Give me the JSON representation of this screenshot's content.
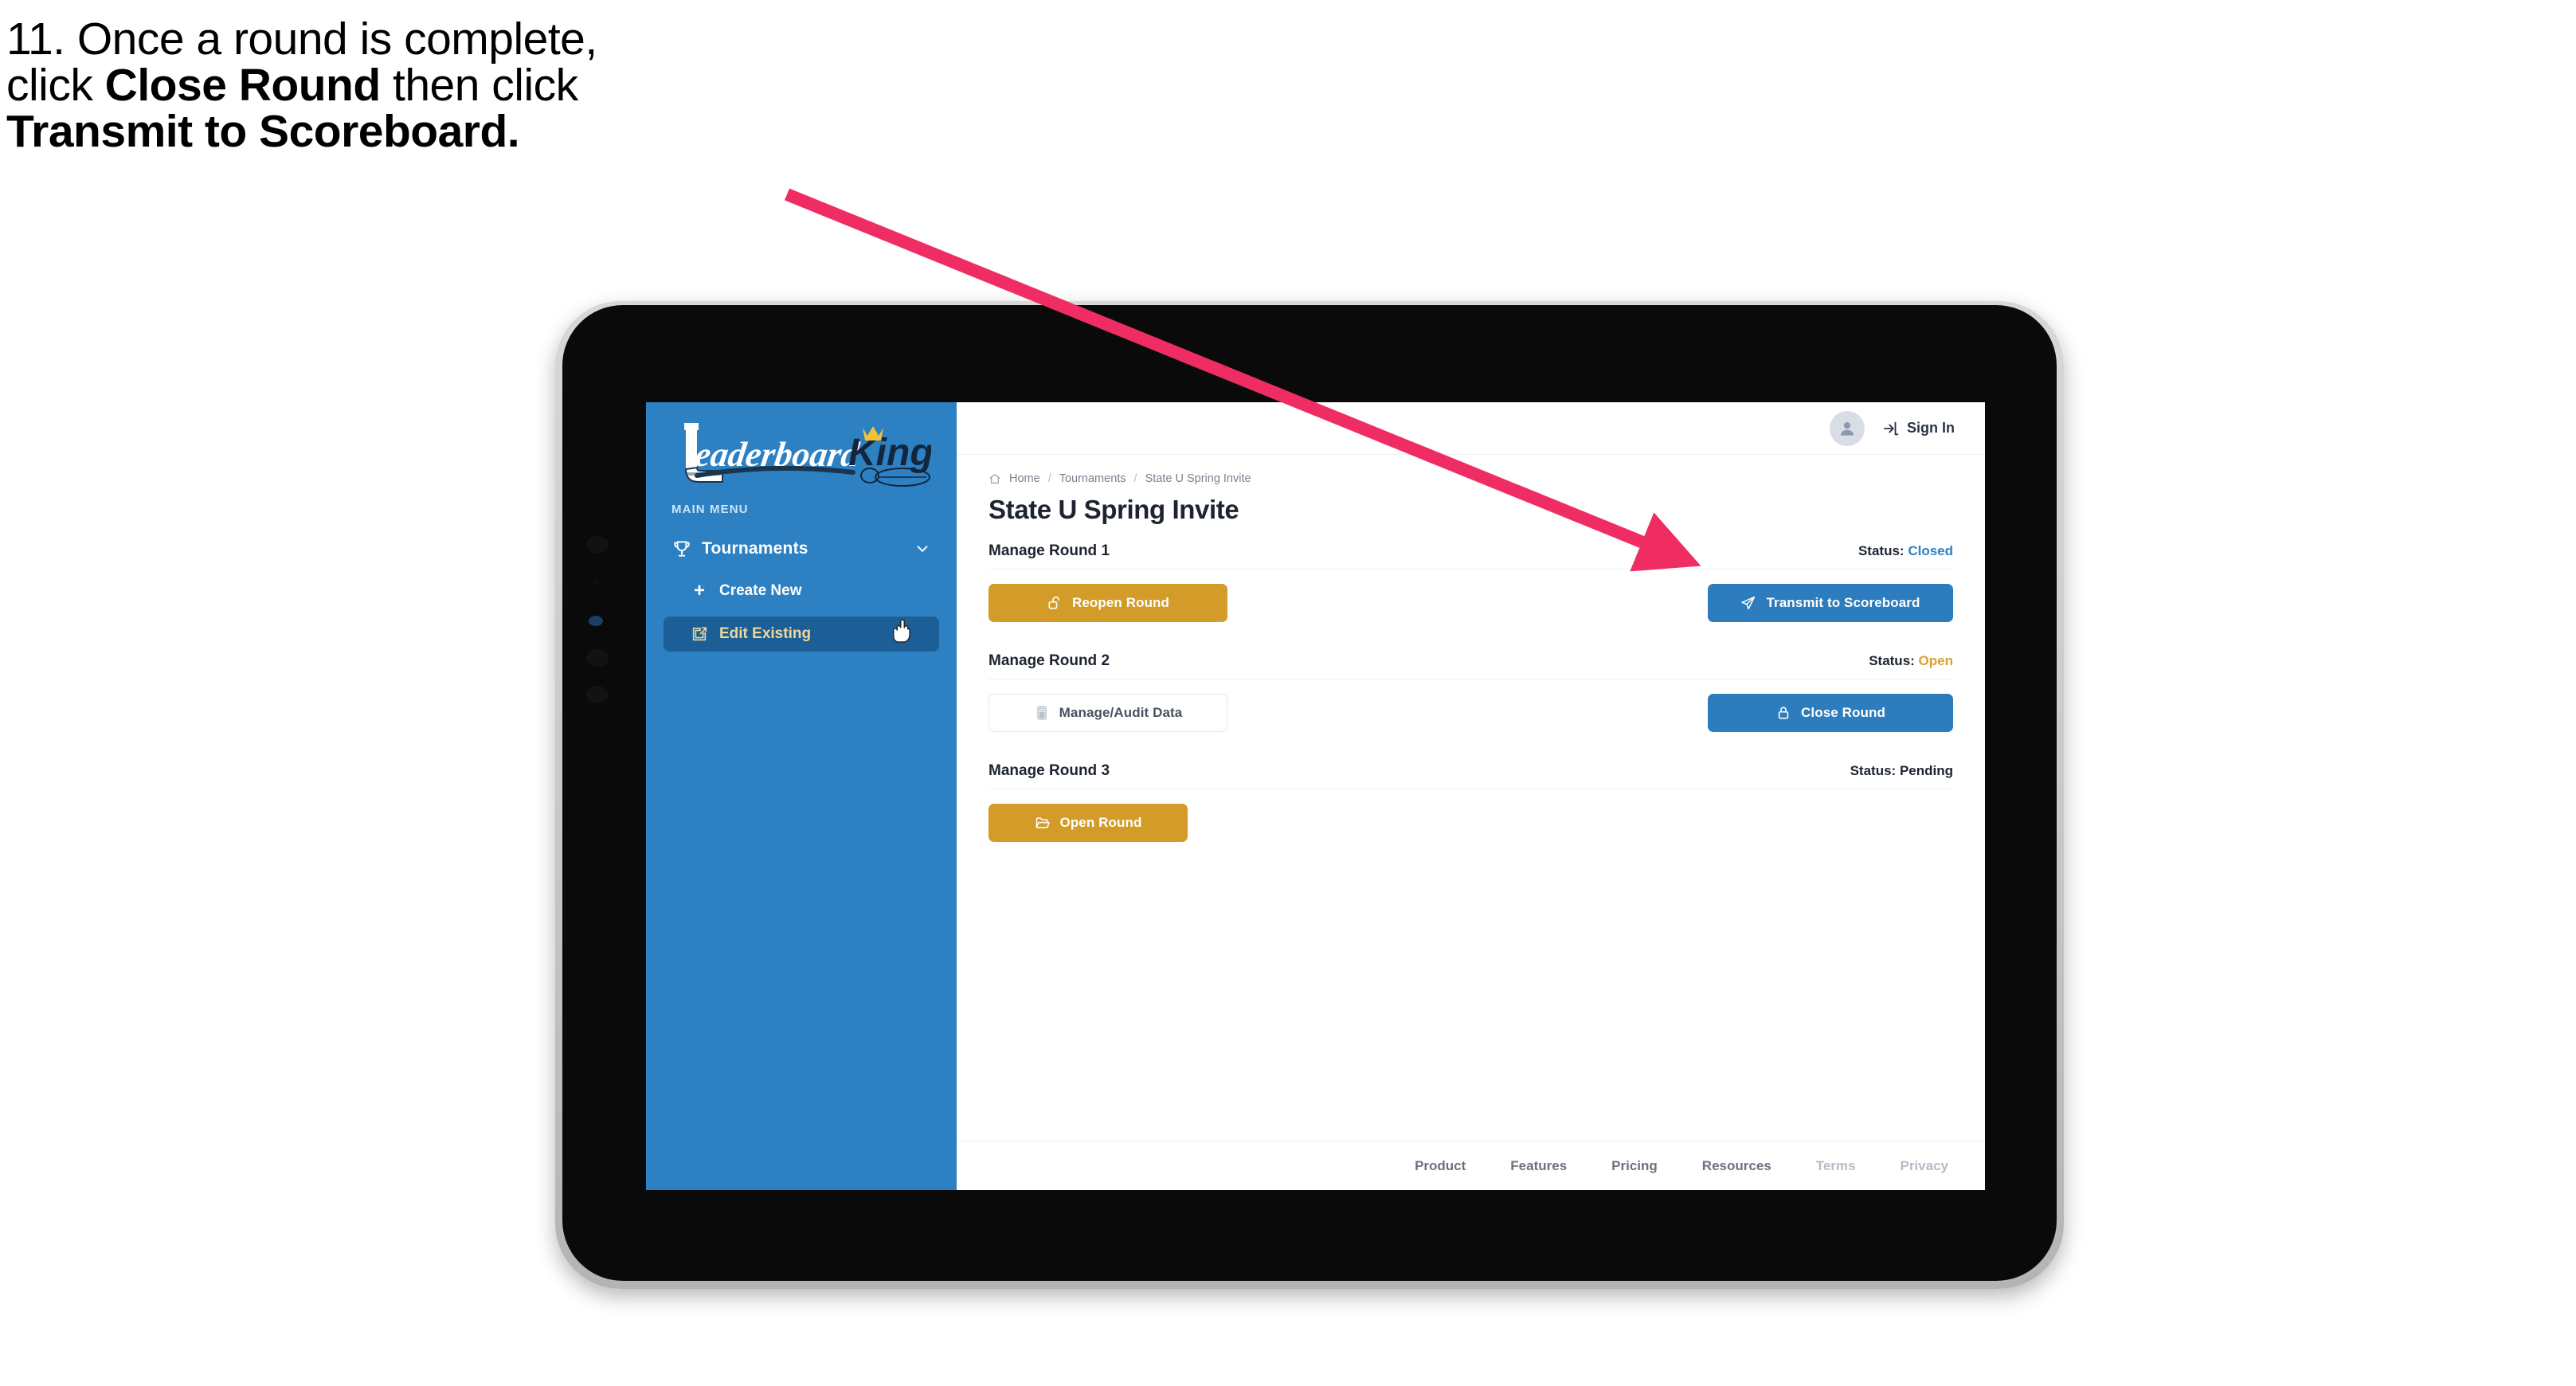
{
  "annotation": {
    "step_number": "11.",
    "line1": "11. Once a round is complete,",
    "line2_pre": "click ",
    "line2_bold": "Close Round",
    "line2_post": " then click",
    "line3_bold": "Transmit to Scoreboard.",
    "arrow_color": "#ef2d63"
  },
  "app": {
    "brand": {
      "name_part1": "Leaderboard",
      "name_part2": "King",
      "sidebar_color": "#2d80c2",
      "accent_gold": "#d39b28",
      "accent_blue": "#2d7cbd"
    },
    "sidebar": {
      "section_label": "MAIN MENU",
      "nav_group": {
        "label": "Tournaments",
        "icon": "trophy-icon",
        "chevron": "chevron-down-icon"
      },
      "items": [
        {
          "label": "Create New",
          "icon": "plus-icon",
          "active": false
        },
        {
          "label": "Edit Existing",
          "icon": "edit-square-icon",
          "active": true
        }
      ]
    },
    "topbar": {
      "avatar_icon": "user-avatar-icon",
      "signin_label": "Sign In",
      "signin_icon": "sign-in-icon"
    },
    "breadcrumb": {
      "home_icon": "home-icon",
      "items": [
        "Home",
        "Tournaments",
        "State U Spring Invite"
      ],
      "separator": "/"
    },
    "page_title": "State U Spring Invite",
    "rounds": [
      {
        "title": "Manage Round 1",
        "status_label": "Status:",
        "status_value": "Closed",
        "status_class": "st-closed",
        "left_button": {
          "label": "Reopen Round",
          "icon": "unlock-icon",
          "style": "gold"
        },
        "right_button": {
          "label": "Transmit to Scoreboard",
          "icon": "paper-plane-icon",
          "style": "blue"
        }
      },
      {
        "title": "Manage Round 2",
        "status_label": "Status:",
        "status_value": "Open",
        "status_class": "st-open",
        "left_button": {
          "label": "Manage/Audit Data",
          "icon": "calculator-icon",
          "style": "ghost"
        },
        "right_button": {
          "label": "Close Round",
          "icon": "lock-icon",
          "style": "blue"
        }
      },
      {
        "title": "Manage Round 3",
        "status_label": "Status:",
        "status_value": "Pending",
        "status_class": "st-pending",
        "left_button": {
          "label": "Open Round",
          "icon": "folder-open-icon",
          "style": "gold"
        },
        "right_button": null
      }
    ],
    "footer": {
      "links": [
        {
          "label": "Product",
          "dim": false
        },
        {
          "label": "Features",
          "dim": false
        },
        {
          "label": "Pricing",
          "dim": false
        },
        {
          "label": "Resources",
          "dim": false
        },
        {
          "label": "Terms",
          "dim": true
        },
        {
          "label": "Privacy",
          "dim": true
        }
      ]
    },
    "cursor": "pointing-hand-cursor"
  }
}
